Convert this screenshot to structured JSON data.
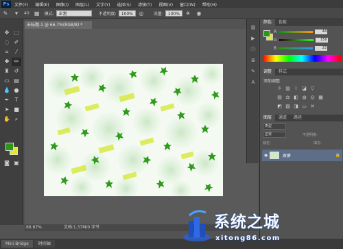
{
  "app": {
    "logo": "Ps"
  },
  "menu": [
    "文件(F)",
    "编辑(E)",
    "图像(I)",
    "图层(L)",
    "文字(Y)",
    "选择(S)",
    "滤镜(T)",
    "视图(V)",
    "窗口(W)",
    "帮助(H)"
  ],
  "options": {
    "brush_size": "40",
    "mode_label": "模式:",
    "mode_value": "正常",
    "opacity_label": "不透明度:",
    "opacity_value": "100%",
    "flow_label": "流量:",
    "flow_value": "100%"
  },
  "document": {
    "tab_title": "未标题-1 @ 66.7%(RGB/8) *",
    "zoom": "66.67%",
    "doc_size": "文档:1.37M/0 字节"
  },
  "bottom_tabs": [
    "Mini Bridge",
    "时间轴"
  ],
  "color_panel": {
    "tabs": [
      "颜色",
      "色板"
    ],
    "channels": [
      {
        "label": "R",
        "value": "44"
      },
      {
        "label": "G",
        "value": "150"
      },
      {
        "label": "B",
        "value": "23"
      }
    ],
    "foreground": "#2c9617",
    "background": "#e1e82a"
  },
  "adjust_panel": {
    "tabs": [
      "调整",
      "样式"
    ],
    "title": "添加调整"
  },
  "layers_panel": {
    "tabs": [
      "图层",
      "通道",
      "路径"
    ],
    "filter_label": "类型",
    "blend_mode": "正常",
    "opacity_label": "不透明度:",
    "lock_label": "锁定:",
    "fill_label": "填充:",
    "layer_name": "背景"
  },
  "watermark": {
    "title": "系统之城",
    "url": "xitong86.com"
  }
}
